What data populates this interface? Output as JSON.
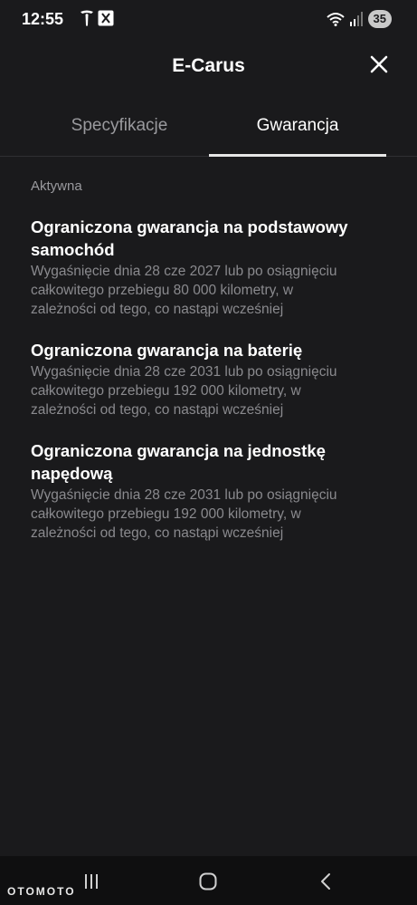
{
  "status_bar": {
    "time": "12:55",
    "battery": "35",
    "icons": [
      "tesla-icon",
      "app-icon",
      "wifi-icon",
      "signal-icon"
    ]
  },
  "header": {
    "title": "E-Carus",
    "close_icon": "close-icon"
  },
  "tabs": [
    {
      "label": "Specyfikacje",
      "active": false
    },
    {
      "label": "Gwarancja",
      "active": true
    }
  ],
  "section": {
    "label": "Aktywna"
  },
  "warranties": [
    {
      "title": "Ograniczona gwarancja na podstawowy samochód",
      "line1": "Wygaśnięcie dnia 28 cze 2027 lub po osiągnięciu",
      "line2": "całkowitego przebiegu 80 000 kilometry, w",
      "line3": "zależności od tego, co nastąpi wcześniej"
    },
    {
      "title": "Ograniczona gwarancja na baterię",
      "line1": "Wygaśnięcie dnia 28 cze 2031 lub po osiągnięciu",
      "line2": "całkowitego przebiegu 192 000 kilometry, w",
      "line3": "zależności od tego, co nastąpi wcześniej"
    },
    {
      "title": "Ograniczona gwarancja na jednostkę napędową",
      "line1": "Wygaśnięcie dnia 28 cze 2031 lub po osiągnięciu",
      "line2": "całkowitego przebiegu 192 000 kilometry, w",
      "line3": "zależności od tego, co nastąpi wcześniej"
    }
  ],
  "nav": {
    "items": [
      "recent-apps-icon",
      "home-icon",
      "back-icon"
    ]
  },
  "watermark": "OTOMOTO",
  "colors": {
    "background": "#1a1a1c",
    "text_primary": "#ffffff",
    "text_secondary": "#8a8a8e",
    "tab_underline": "#e6e6e6"
  }
}
